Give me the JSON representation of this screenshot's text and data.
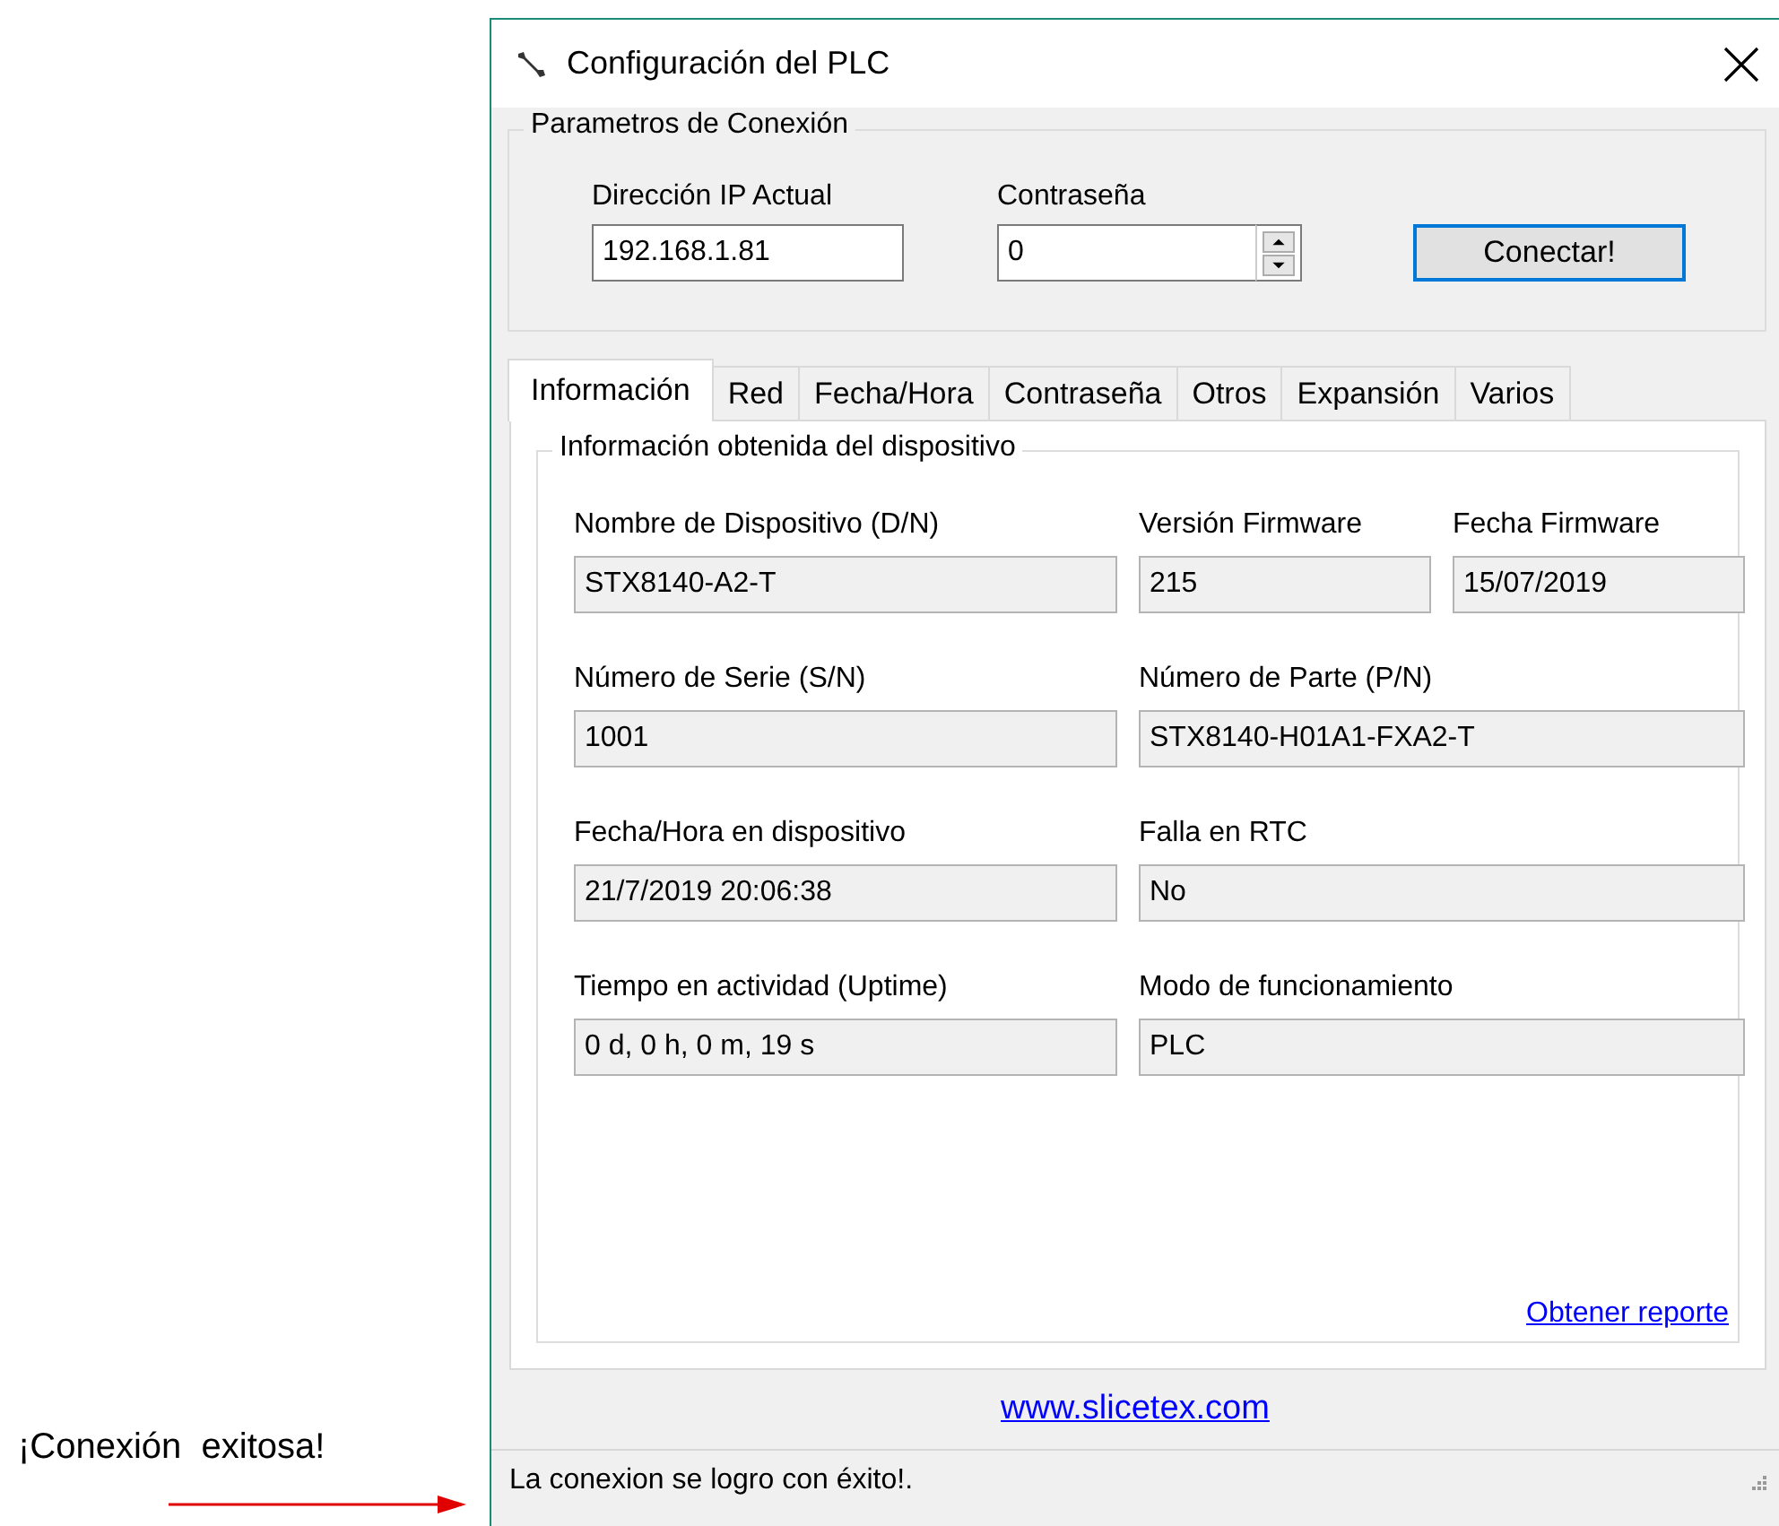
{
  "annotation": {
    "text": "¡Conexión  exitosa!"
  },
  "window": {
    "title": "Configuración del PLC"
  },
  "connection": {
    "title": "Parametros de Conexión",
    "ip_label": "Dirección IP Actual",
    "ip_value": "192.168.1.81",
    "password_label": "Contraseña",
    "password_value": "0",
    "connect_button": "Conectar!"
  },
  "tabs": [
    {
      "label": "Información",
      "selected": true
    },
    {
      "label": "Red",
      "selected": false
    },
    {
      "label": "Fecha/Hora",
      "selected": false
    },
    {
      "label": "Contraseña",
      "selected": false
    },
    {
      "label": "Otros",
      "selected": false
    },
    {
      "label": "Expansión",
      "selected": false
    },
    {
      "label": "Varios",
      "selected": false
    }
  ],
  "device_info": {
    "title": "Información obtenida del dispositivo",
    "rows": [
      [
        {
          "label": "Nombre de Dispositivo (D/N)",
          "value": "STX8140-A2-T"
        },
        {
          "label": "Versión Firmware",
          "value": "215"
        },
        {
          "label": "Fecha Firmware",
          "value": "15/07/2019"
        }
      ],
      [
        {
          "label": "Número de Serie (S/N)",
          "value": "1001"
        },
        {
          "label": "Número de Parte (P/N)",
          "value": "STX8140-H01A1-FXA2-T"
        }
      ],
      [
        {
          "label": "Fecha/Hora en dispositivo",
          "value": "21/7/2019 20:06:38"
        },
        {
          "label": "Falla en RTC",
          "value": "No"
        }
      ],
      [
        {
          "label": "Tiempo en actividad (Uptime)",
          "value": "0 d, 0 h, 0 m, 19 s"
        },
        {
          "label": "Modo de funcionamiento",
          "value": "PLC"
        }
      ]
    ],
    "report_link": "Obtener reporte"
  },
  "footer_link": "www.slicetex.com",
  "status_bar": {
    "text": "La conexion se logro con éxito!."
  }
}
